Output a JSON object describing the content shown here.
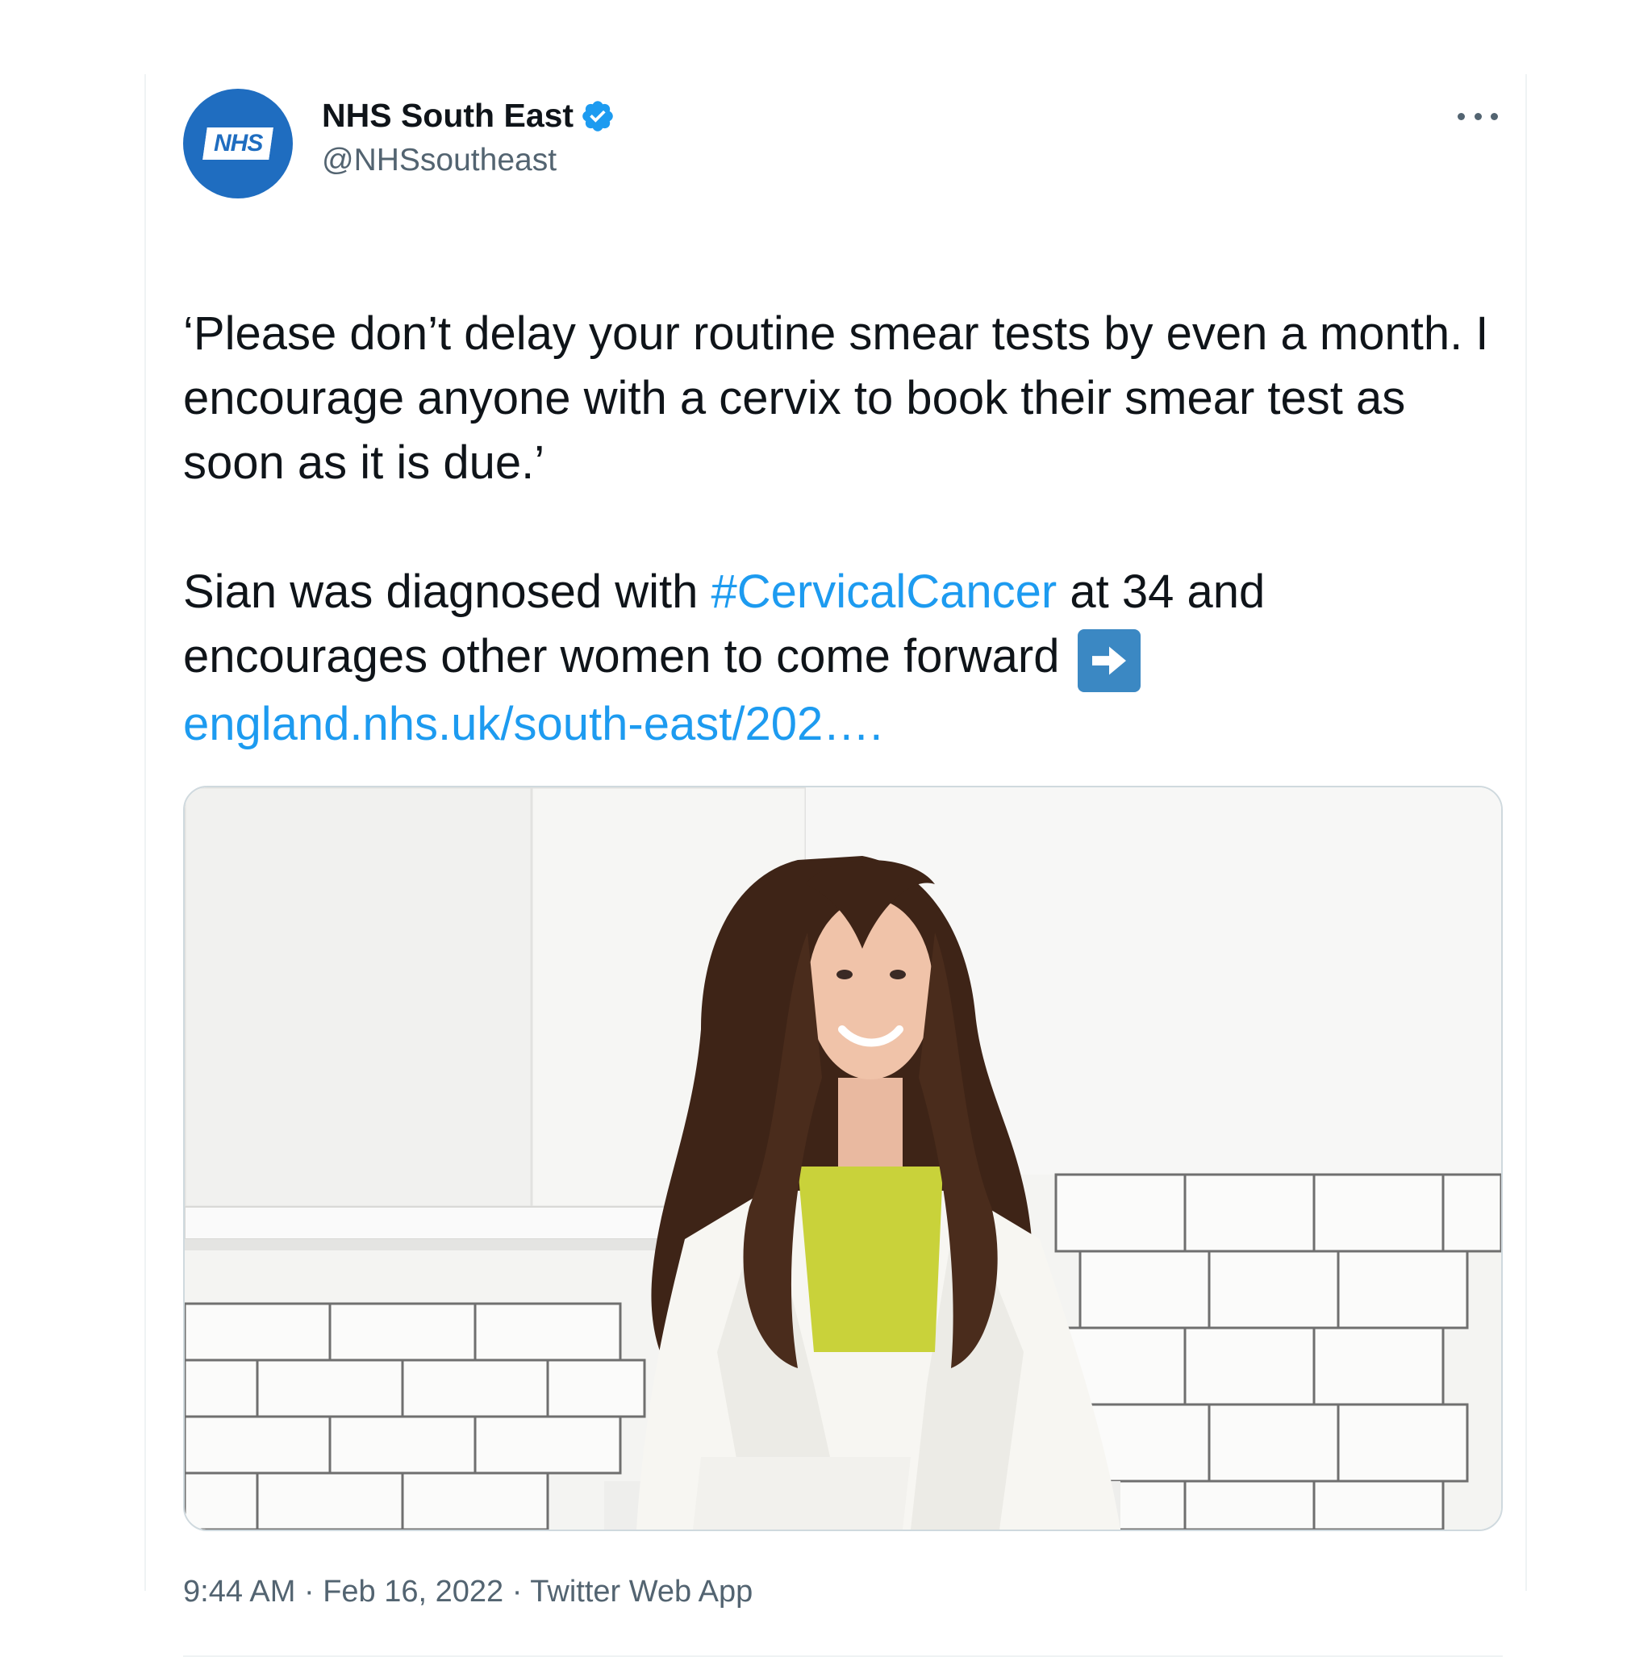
{
  "tweet": {
    "author": {
      "display_name": "NHS South East",
      "handle": "@NHSsoutheast",
      "avatar_logo_text": "NHS",
      "verified": true
    },
    "text": {
      "paragraph1": "‘Please don’t delay your routine smear tests by even a month. I encourage anyone with a cervix to book their smear test as soon as it is due.’",
      "p2_before_hashtag": "Sian was diagnosed with ",
      "hashtag": "#CervicalCancer",
      "p2_after_hashtag": " at 34 and encourages other women to come forward ",
      "link": "england.nhs.uk/south-east/202….",
      "emoji": "right-arrow-emoji"
    },
    "media": {
      "kind": "photo",
      "alt_description_icon": "photo-woman-smiling-in-white-kitchen"
    },
    "meta": {
      "time": "9:44 AM",
      "date": "Feb 16, 2022",
      "source": "Twitter Web App",
      "separator": " · "
    }
  },
  "colors": {
    "accent": "#1d9bf0",
    "nhs_blue": "#1f6dc0",
    "text_primary": "#0f1419",
    "text_secondary": "#536471",
    "emoji_blue": "#3b88c3"
  },
  "icons": {
    "verified": "verified-badge-icon",
    "more": "more-options-icon"
  }
}
